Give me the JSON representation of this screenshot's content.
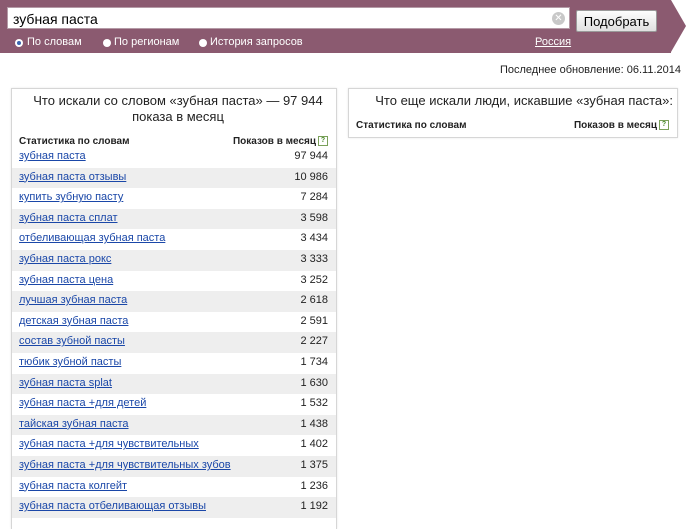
{
  "search": {
    "query": "зубная паста",
    "button_label": "Подобрать",
    "modes": [
      "По словам",
      "По регионам",
      "История запросов"
    ],
    "region": "Россия"
  },
  "last_update": "Последнее обновление: 06.11.2014",
  "left_panel": {
    "title": "Что искали со словом «зубная паста» — 97 944 показа в месяц",
    "col_keyword": "Статистика по словам",
    "col_count": "Показов в месяц",
    "rows": [
      {
        "keyword": "зубная паста",
        "count": "97 944"
      },
      {
        "keyword": "зубная паста отзывы",
        "count": "10 986"
      },
      {
        "keyword": "купить зубную пасту",
        "count": "7 284"
      },
      {
        "keyword": "зубная паста сплат",
        "count": "3 598"
      },
      {
        "keyword": "отбеливающая зубная паста",
        "count": "3 434"
      },
      {
        "keyword": "зубная паста рокс",
        "count": "3 333"
      },
      {
        "keyword": "зубная паста цена",
        "count": "3 252"
      },
      {
        "keyword": "лучшая зубная паста",
        "count": "2 618"
      },
      {
        "keyword": "детская зубная паста",
        "count": "2 591"
      },
      {
        "keyword": "состав зубной пасты",
        "count": "2 227"
      },
      {
        "keyword": "тюбик зубной пасты",
        "count": "1 734"
      },
      {
        "keyword": "зубная паста splat",
        "count": "1 630"
      },
      {
        "keyword": "зубная паста +для детей",
        "count": "1 532"
      },
      {
        "keyword": "тайская зубная паста",
        "count": "1 438"
      },
      {
        "keyword": "зубная паста +для чувствительных",
        "count": "1 402"
      },
      {
        "keyword": "зубная паста +для чувствительных зубов",
        "count": "1 375"
      },
      {
        "keyword": "зубная паста колгейт",
        "count": "1 236"
      },
      {
        "keyword": "зубная паста отбеливающая отзывы",
        "count": "1 192"
      }
    ]
  },
  "right_panel": {
    "title": "Что еще искали люди, искавшие «зубная паста»:",
    "col_keyword": "Статистика по словам",
    "col_count": "Показов в месяц"
  }
}
